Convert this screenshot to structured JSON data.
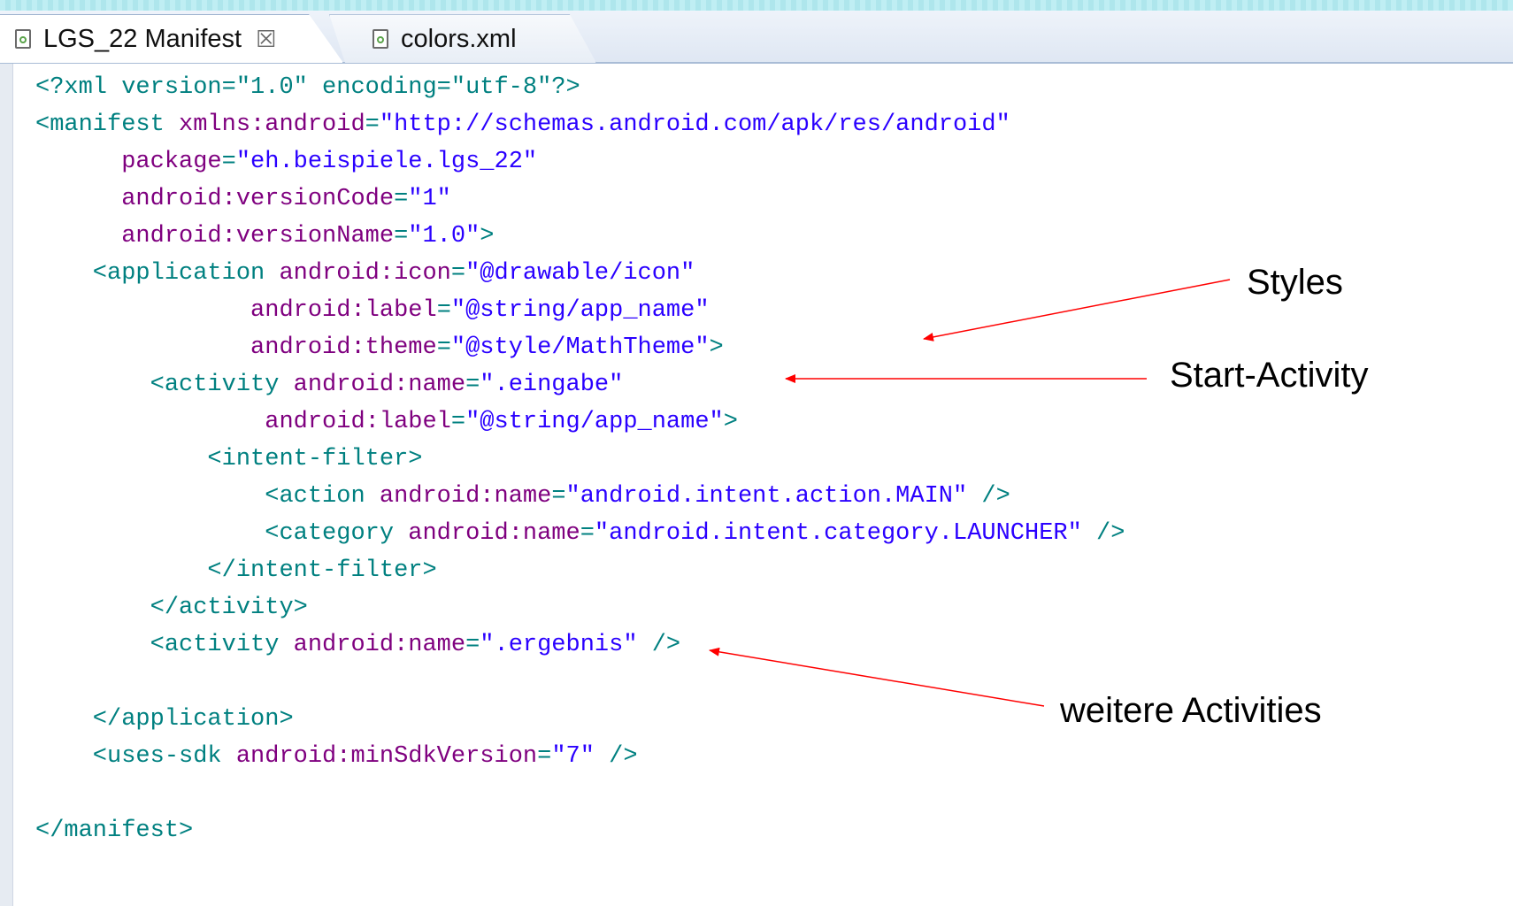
{
  "tabs": [
    {
      "label": "LGS_22 Manifest",
      "close": "☒",
      "icon": "xml-file-icon",
      "active": true
    },
    {
      "label": "colors.xml",
      "icon": "xml-file-icon",
      "active": false
    }
  ],
  "code": {
    "lines": [
      [
        {
          "t": "pi",
          "v": "<?xml version=\"1.0\" encoding=\"utf-8\"?>"
        }
      ],
      [
        {
          "t": "tk",
          "v": "<manifest "
        },
        {
          "t": "at",
          "v": "xmlns:android"
        },
        {
          "t": "punc",
          "v": "="
        },
        {
          "t": "val",
          "v": "\"http://schemas.android.com/apk/res/android\""
        }
      ],
      [
        {
          "t": "tk",
          "v": "      "
        },
        {
          "t": "at",
          "v": "package"
        },
        {
          "t": "punc",
          "v": "="
        },
        {
          "t": "val",
          "v": "\"eh.beispiele.lgs_22\""
        }
      ],
      [
        {
          "t": "tk",
          "v": "      "
        },
        {
          "t": "at",
          "v": "android:versionCode"
        },
        {
          "t": "punc",
          "v": "="
        },
        {
          "t": "val",
          "v": "\"1\""
        }
      ],
      [
        {
          "t": "tk",
          "v": "      "
        },
        {
          "t": "at",
          "v": "android:versionName"
        },
        {
          "t": "punc",
          "v": "="
        },
        {
          "t": "val",
          "v": "\"1.0\""
        },
        {
          "t": "tk",
          "v": ">"
        }
      ],
      [
        {
          "t": "tk",
          "v": "    <application "
        },
        {
          "t": "at",
          "v": "android:icon"
        },
        {
          "t": "punc",
          "v": "="
        },
        {
          "t": "val",
          "v": "\"@drawable/icon\""
        }
      ],
      [
        {
          "t": "tk",
          "v": "               "
        },
        {
          "t": "at",
          "v": "android:label"
        },
        {
          "t": "punc",
          "v": "="
        },
        {
          "t": "val",
          "v": "\"@string/app_name\""
        }
      ],
      [
        {
          "t": "tk",
          "v": "               "
        },
        {
          "t": "at",
          "v": "android:theme"
        },
        {
          "t": "punc",
          "v": "="
        },
        {
          "t": "val",
          "v": "\"@style/MathTheme\""
        },
        {
          "t": "tk",
          "v": ">"
        }
      ],
      [
        {
          "t": "tk",
          "v": "        <activity "
        },
        {
          "t": "at",
          "v": "android:name"
        },
        {
          "t": "punc",
          "v": "="
        },
        {
          "t": "val",
          "v": "\".eingabe\""
        }
      ],
      [
        {
          "t": "tk",
          "v": "                "
        },
        {
          "t": "at",
          "v": "android:label"
        },
        {
          "t": "punc",
          "v": "="
        },
        {
          "t": "val",
          "v": "\"@string/app_name\""
        },
        {
          "t": "tk",
          "v": ">"
        }
      ],
      [
        {
          "t": "tk",
          "v": "            <intent-filter>"
        }
      ],
      [
        {
          "t": "tk",
          "v": "                <action "
        },
        {
          "t": "at",
          "v": "android:name"
        },
        {
          "t": "punc",
          "v": "="
        },
        {
          "t": "val",
          "v": "\"android.intent.action.MAIN\""
        },
        {
          "t": "tk",
          "v": " />"
        }
      ],
      [
        {
          "t": "tk",
          "v": "                <category "
        },
        {
          "t": "at",
          "v": "android:name"
        },
        {
          "t": "punc",
          "v": "="
        },
        {
          "t": "val",
          "v": "\"android.intent.category.LAUNCHER\""
        },
        {
          "t": "tk",
          "v": " />"
        }
      ],
      [
        {
          "t": "tk",
          "v": "            </intent-filter>"
        }
      ],
      [
        {
          "t": "tk",
          "v": "        </activity>"
        }
      ],
      [
        {
          "t": "tk",
          "v": "        <activity "
        },
        {
          "t": "at",
          "v": "android:name"
        },
        {
          "t": "punc",
          "v": "="
        },
        {
          "t": "val",
          "v": "\".ergebnis\""
        },
        {
          "t": "tk",
          "v": " />"
        }
      ],
      [],
      [
        {
          "t": "tk",
          "v": "    </application>"
        }
      ],
      [
        {
          "t": "tk",
          "v": "    <uses-sdk "
        },
        {
          "t": "at",
          "v": "android:minSdkVersion"
        },
        {
          "t": "punc",
          "v": "="
        },
        {
          "t": "val",
          "v": "\"7\""
        },
        {
          "t": "tk",
          "v": " />"
        }
      ],
      [],
      [
        {
          "t": "tk",
          "v": "</manifest>"
        }
      ]
    ]
  },
  "annotations": {
    "styles": "Styles",
    "start_activity": "Start-Activity",
    "weitere": "weitere Activities"
  },
  "colors": {
    "tag": "#008080",
    "attribute": "#7f007f",
    "value": "#2a00ff",
    "arrow": "#ff0000"
  }
}
